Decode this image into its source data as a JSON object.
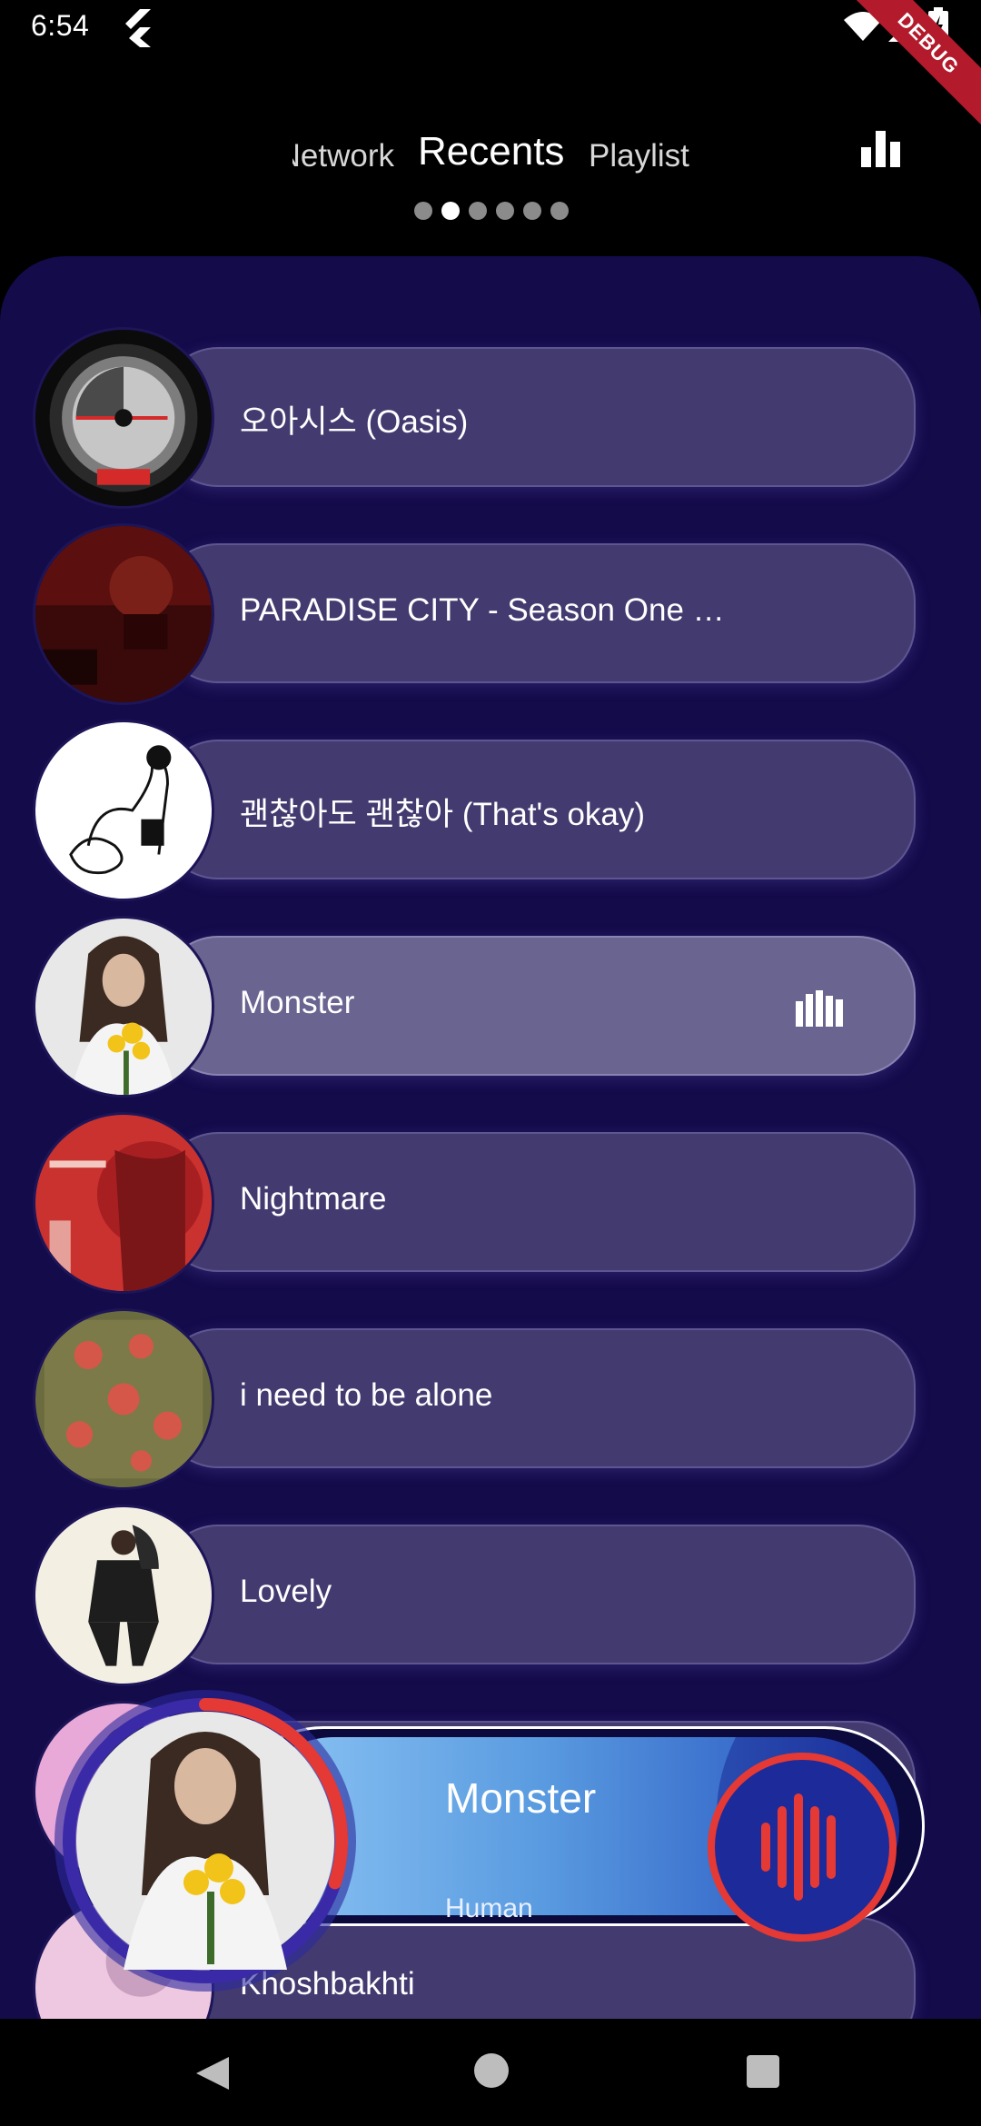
{
  "status_bar": {
    "time": "6:54",
    "debug_label": "DEBUG"
  },
  "tabs": {
    "items": [
      "Network",
      "Recents",
      "Playlist"
    ],
    "active": "Recents",
    "page_count": 6,
    "active_page": 2
  },
  "tracks": [
    {
      "title": "오아시스 (Oasis)",
      "playing": false
    },
    {
      "title": "PARADISE CITY - Season One …",
      "playing": false
    },
    {
      "title": "괜찮아도 괜찮아 (That's okay)",
      "playing": false
    },
    {
      "title": "Monster",
      "playing": true
    },
    {
      "title": "Nightmare",
      "playing": false
    },
    {
      "title": "i need to be alone",
      "playing": false
    },
    {
      "title": "Lovely",
      "playing": false
    },
    {
      "title": "",
      "playing": false
    },
    {
      "title": "Khoshbakhti",
      "playing": false
    }
  ],
  "now_playing": {
    "title": "Monster",
    "artist": "Human",
    "progress": 0.3
  },
  "colors": {
    "background": "#000000",
    "panel": "#140b4b",
    "pill": "#433b70",
    "pill_active": "#6a6491",
    "accent_red": "#e53935",
    "player_blue": "#4a8fd8"
  },
  "icons": [
    "flutter-icon",
    "wifi-icon",
    "signal-icon",
    "battery-icon",
    "stats-icon",
    "equalizer-icon",
    "waveform-icon",
    "back-icon",
    "home-icon",
    "recents-icon"
  ]
}
